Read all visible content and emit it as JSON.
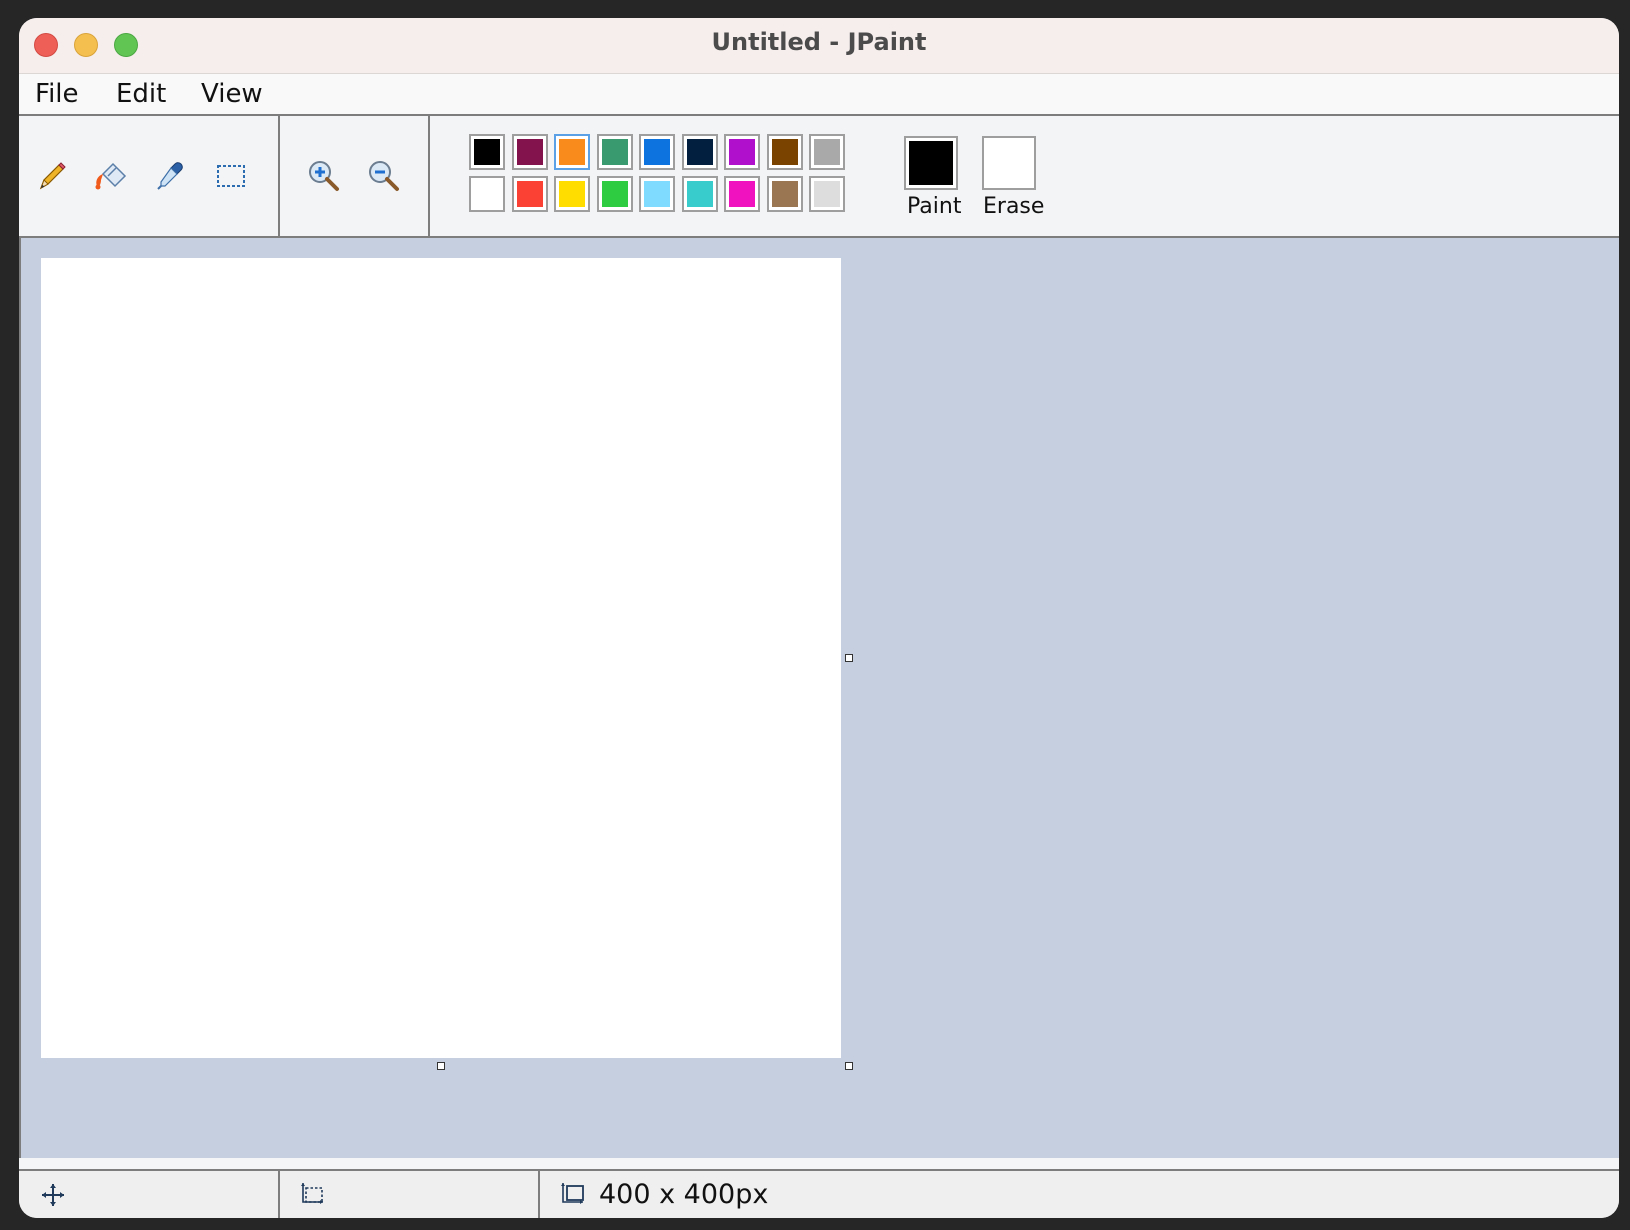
{
  "window": {
    "title": "Untitled - JPaint"
  },
  "menu": {
    "items": [
      "File",
      "Edit",
      "View"
    ]
  },
  "toolbar": {
    "tools": [
      "pencil-icon",
      "fill-bucket-icon",
      "color-picker-icon",
      "rectangle-select-icon"
    ],
    "zoom": [
      "zoom-in-icon",
      "zoom-out-icon"
    ],
    "palette": {
      "row1": [
        "#000000",
        "#82134d",
        "#f98b1c",
        "#3a9a6f",
        "#0d73de",
        "#021f3f",
        "#b00fcc",
        "#7a4300",
        "#a9a9a9"
      ],
      "row2": [
        "#ffffff",
        "#fb4133",
        "#ffdd00",
        "#2ecc40",
        "#7fdbff",
        "#39cccc",
        "#f012be",
        "#9b7653",
        "#dddddd"
      ],
      "selected_color": "#f98b1c"
    },
    "paint_label": "Paint",
    "erase_label": "Erase",
    "paint_color": "#000000",
    "erase_color": "#ffffff"
  },
  "canvas": {
    "background": "#ffffff"
  },
  "status": {
    "icons": [
      "move-icon",
      "selection-size-icon",
      "canvas-size-icon"
    ],
    "canvas_size_text": "400 x 400px"
  }
}
